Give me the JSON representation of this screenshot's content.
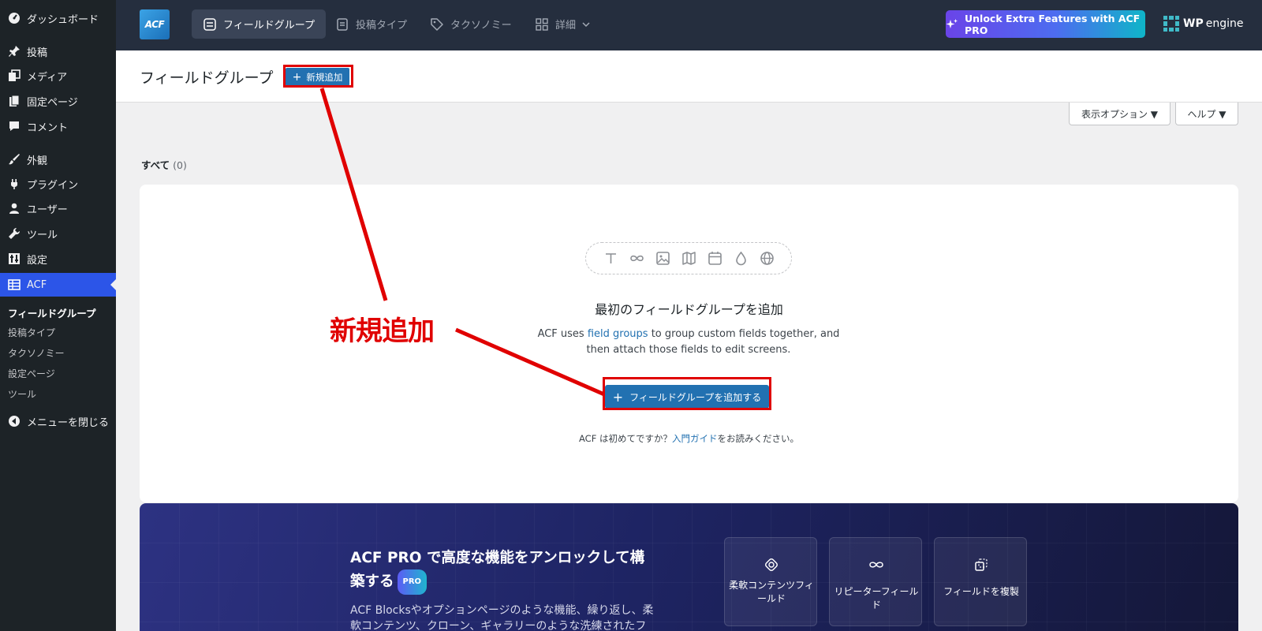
{
  "sidebar": {
    "items": [
      {
        "label": "ダッシュボード",
        "icon": "dashboard-icon"
      },
      {
        "label": "投稿",
        "icon": "pin-icon"
      },
      {
        "label": "メディア",
        "icon": "media-icon"
      },
      {
        "label": "固定ページ",
        "icon": "pages-icon"
      },
      {
        "label": "コメント",
        "icon": "comment-icon"
      },
      {
        "label": "外観",
        "icon": "brush-icon"
      },
      {
        "label": "プラグイン",
        "icon": "plugin-icon"
      },
      {
        "label": "ユーザー",
        "icon": "user-icon"
      },
      {
        "label": "ツール",
        "icon": "wrench-icon"
      },
      {
        "label": "設定",
        "icon": "settings-icon"
      },
      {
        "label": "ACF",
        "icon": "acf-table-icon"
      }
    ],
    "submenu": [
      "フィールドグループ",
      "投稿タイプ",
      "タクソノミー",
      "設定ページ",
      "ツール"
    ],
    "collapse": "メニューを閉じる"
  },
  "topbar": {
    "logo": "ACF",
    "nav": [
      "フィールドグループ",
      "投稿タイプ",
      "タクソノミー",
      "詳細"
    ],
    "unlock": "Unlock Extra Features with ACF PRO",
    "wp_engine_bold": "WP",
    "wp_engine_rest": "engine"
  },
  "header": {
    "title": "フィールドグループ",
    "add_new": "新規追加"
  },
  "screen_options": {
    "display": "表示オプション ▼",
    "help": "ヘルプ ▼"
  },
  "filter": {
    "all": "すべて",
    "count": "(0)"
  },
  "empty": {
    "heading": "最初のフィールドグループを追加",
    "desc_pre": "ACF uses ",
    "desc_link": "field groups",
    "desc_post": " to group custom fields together, and then attach those fields to edit screens.",
    "button": "フィールドグループを追加する",
    "guide_pre": "ACF は初めてですか？",
    "guide_link": "入門ガイド",
    "guide_post": "をお読みください。"
  },
  "pro": {
    "title": "ACF PRO で高度な機能をアンロックして構築する",
    "badge": "PRO",
    "desc": "ACF Blocksやオプションページのような機能、繰り返し、柔軟コンテンツ、クローン、ギャラリーのような洗練されたフィ",
    "features": [
      "柔軟コンテンツフィールド",
      "リピーターフィールド",
      "フィールドを複製"
    ]
  },
  "annotation": {
    "label": "新規追加",
    "color": "#e00000"
  },
  "colors": {
    "sidebar_bg": "#1d2327",
    "sidebar_active": "#2c55e8",
    "topbar_bg": "#252e3e",
    "primary": "#2271b1"
  }
}
